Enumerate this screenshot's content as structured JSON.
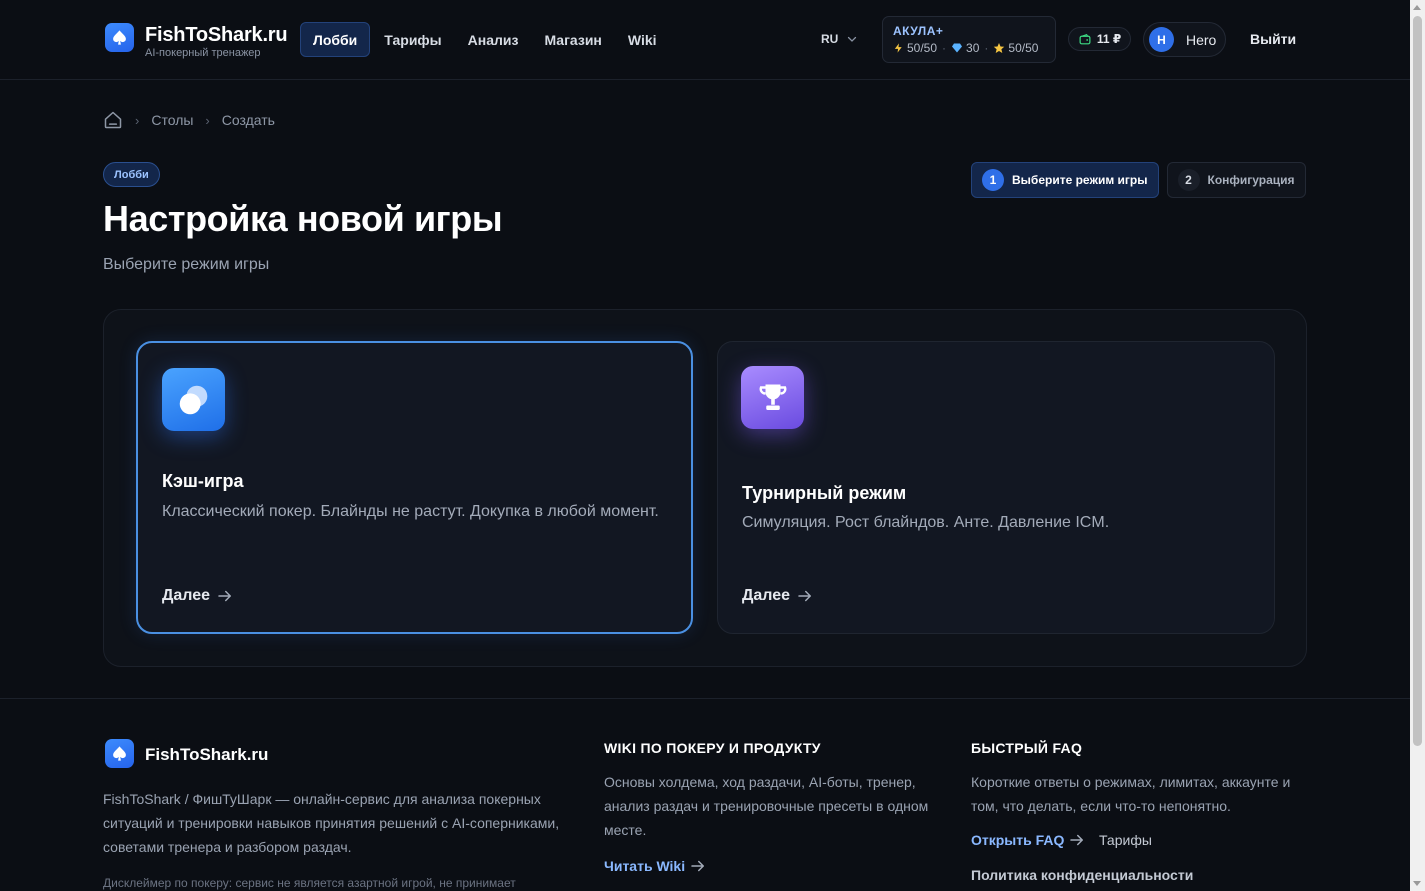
{
  "header": {
    "brand_title": "FishToShark.ru",
    "brand_subtitle": "AI-покерный тренажер",
    "nav": [
      {
        "label": "Лобби",
        "active": true
      },
      {
        "label": "Тарифы",
        "active": false
      },
      {
        "label": "Анализ",
        "active": false
      },
      {
        "label": "Магазин",
        "active": false
      },
      {
        "label": "Wiki",
        "active": false
      }
    ],
    "language": "RU",
    "plan": {
      "name": "АКУЛА+",
      "energy": "50/50",
      "gems": "30",
      "stars": "50/50"
    },
    "wallet": "11 ₽",
    "user": {
      "initial": "H",
      "name": "Hero"
    },
    "logout_label": "Выйти"
  },
  "breadcrumb": {
    "items": [
      "Столы",
      "Создать"
    ]
  },
  "page": {
    "badge": "Лобби",
    "title": "Настройка новой игры",
    "subtitle": "Выберите режим игры"
  },
  "steps": [
    {
      "num": "1",
      "label": "Выберите режим игры",
      "active": true
    },
    {
      "num": "2",
      "label": "Конфигурация",
      "active": false
    }
  ],
  "modes": [
    {
      "title": "Кэш-игра",
      "description": "Классический покер. Блайнды не растут. Докупка в любой момент.",
      "next_label": "Далее",
      "selected": true
    },
    {
      "title": "Турнирный режим",
      "description": "Симуляция. Рост блайндов. Анте. Давление ICM.",
      "next_label": "Далее",
      "selected": false
    }
  ],
  "footer": {
    "brand": "FishToShark.ru",
    "about": "FishToShark / ФишТуШарк — онлайн-сервис для анализа покерных ситуаций и тренировки навыков принятия решений с AI-соперниками, советами тренера и разбором раздач.",
    "disclaimer": "Дисклеймер по покеру: сервис не является азартной игрой, не принимает",
    "wiki": {
      "heading": "WIKI ПО ПОКЕРУ И ПРОДУКТУ",
      "text": "Основы холдема, ход раздачи, AI-боты, тренер, анализ раздач и тренировочные пресеты в одном месте.",
      "link": "Читать Wiki"
    },
    "faq": {
      "heading": "БЫСТРЫЙ FAQ",
      "text": "Короткие ответы о режимах, лимитах, аккаунте и том, что делать, если что-то непонятно.",
      "link": "Открыть FAQ",
      "tariffs": "Тарифы",
      "privacy": "Политика конфиденциальности"
    }
  },
  "colors": {
    "background": "#0b0e14",
    "accent": "#2f6fe8",
    "accent_light": "#9cc3ff",
    "purple": "#7c5cf0"
  }
}
